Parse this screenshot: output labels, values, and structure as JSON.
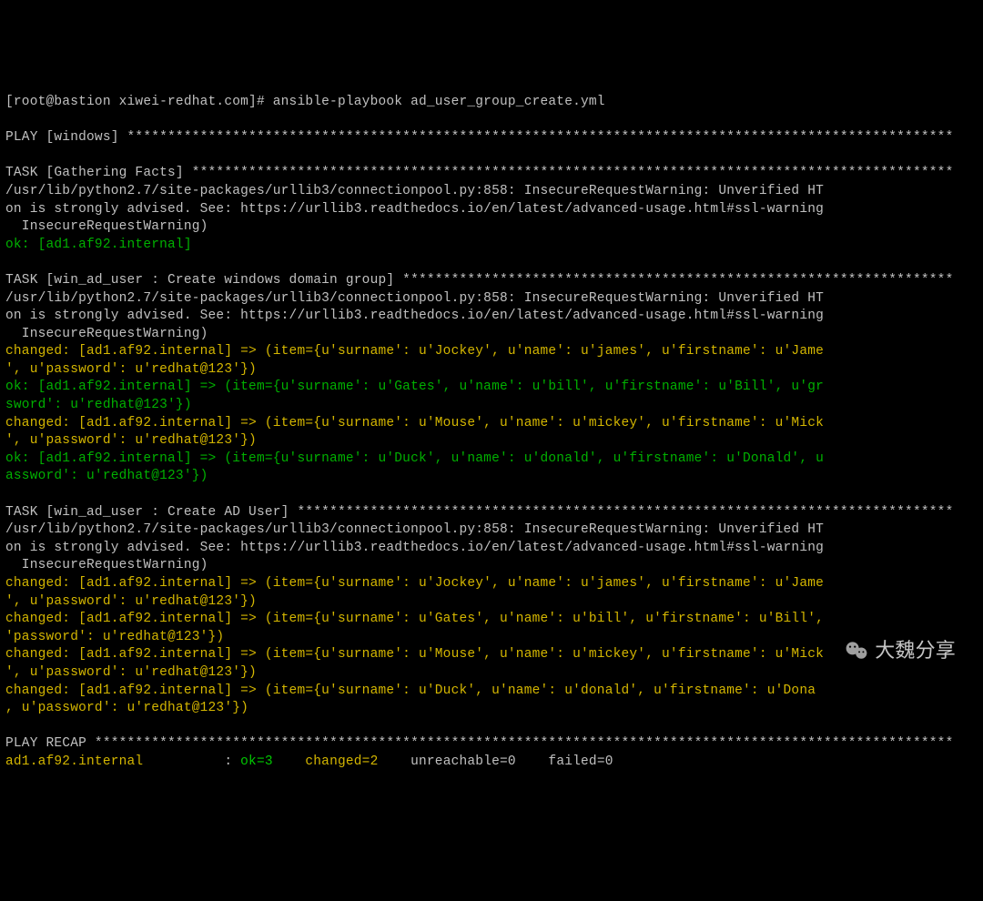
{
  "prompt": "[root@bastion xiwei-redhat.com]# ansible-playbook ad_user_group_create.yml",
  "play_header": "PLAY [windows] ******************************************************************************************************",
  "task_gathering": "TASK [Gathering Facts] **********************************************************************************************",
  "warning_line1": "/usr/lib/python2.7/site-packages/urllib3/connectionpool.py:858: InsecureRequestWarning: Unverified HT",
  "warning_line2": "on is strongly advised. See: https://urllib3.readthedocs.io/en/latest/advanced-usage.html#ssl-warning",
  "warning_line3": "  InsecureRequestWarning)",
  "ok_host": "ok: [ad1.af92.internal]",
  "task_group": "TASK [win_ad_user : Create windows domain group] ********************************************************************",
  "changed_item1a": "changed: [ad1.af92.internal] => (item={u'surname': u'Jockey', u'name': u'james', u'firstname': u'Jame",
  "changed_item1b": "', u'password': u'redhat@123'})",
  "ok_item2a": "ok: [ad1.af92.internal] => (item={u'surname': u'Gates', u'name': u'bill', u'firstname': u'Bill', u'gr",
  "ok_item2b": "sword': u'redhat@123'})",
  "changed_item3a": "changed: [ad1.af92.internal] => (item={u'surname': u'Mouse', u'name': u'mickey', u'firstname': u'Mick",
  "changed_item3b": "', u'password': u'redhat@123'})",
  "ok_item4a": "ok: [ad1.af92.internal] => (item={u'surname': u'Duck', u'name': u'donald', u'firstname': u'Donald', u",
  "ok_item4b": "assword': u'redhat@123'})",
  "task_user": "TASK [win_ad_user : Create AD User] *********************************************************************************",
  "changed_u1a": "changed: [ad1.af92.internal] => (item={u'surname': u'Jockey', u'name': u'james', u'firstname': u'Jame",
  "changed_u1b": "', u'password': u'redhat@123'})",
  "changed_u2a": "changed: [ad1.af92.internal] => (item={u'surname': u'Gates', u'name': u'bill', u'firstname': u'Bill',",
  "changed_u2b": "'password': u'redhat@123'})",
  "changed_u3a": "changed: [ad1.af92.internal] => (item={u'surname': u'Mouse', u'name': u'mickey', u'firstname': u'Mick",
  "changed_u3b": "', u'password': u'redhat@123'})",
  "changed_u4a": "changed: [ad1.af92.internal] => (item={u'surname': u'Duck', u'name': u'donald', u'firstname': u'Dona",
  "changed_u4b": ", u'password': u'redhat@123'})",
  "recap_header": "PLAY RECAP **********************************************************************************************************",
  "recap_host": "ad1.af92.internal",
  "recap_sep": "          : ",
  "recap_ok": "ok=3",
  "recap_changed": "    changed=2",
  "recap_unreach": "    unreachable=0",
  "recap_failed": "    failed=0",
  "watermark": "大魏分享"
}
